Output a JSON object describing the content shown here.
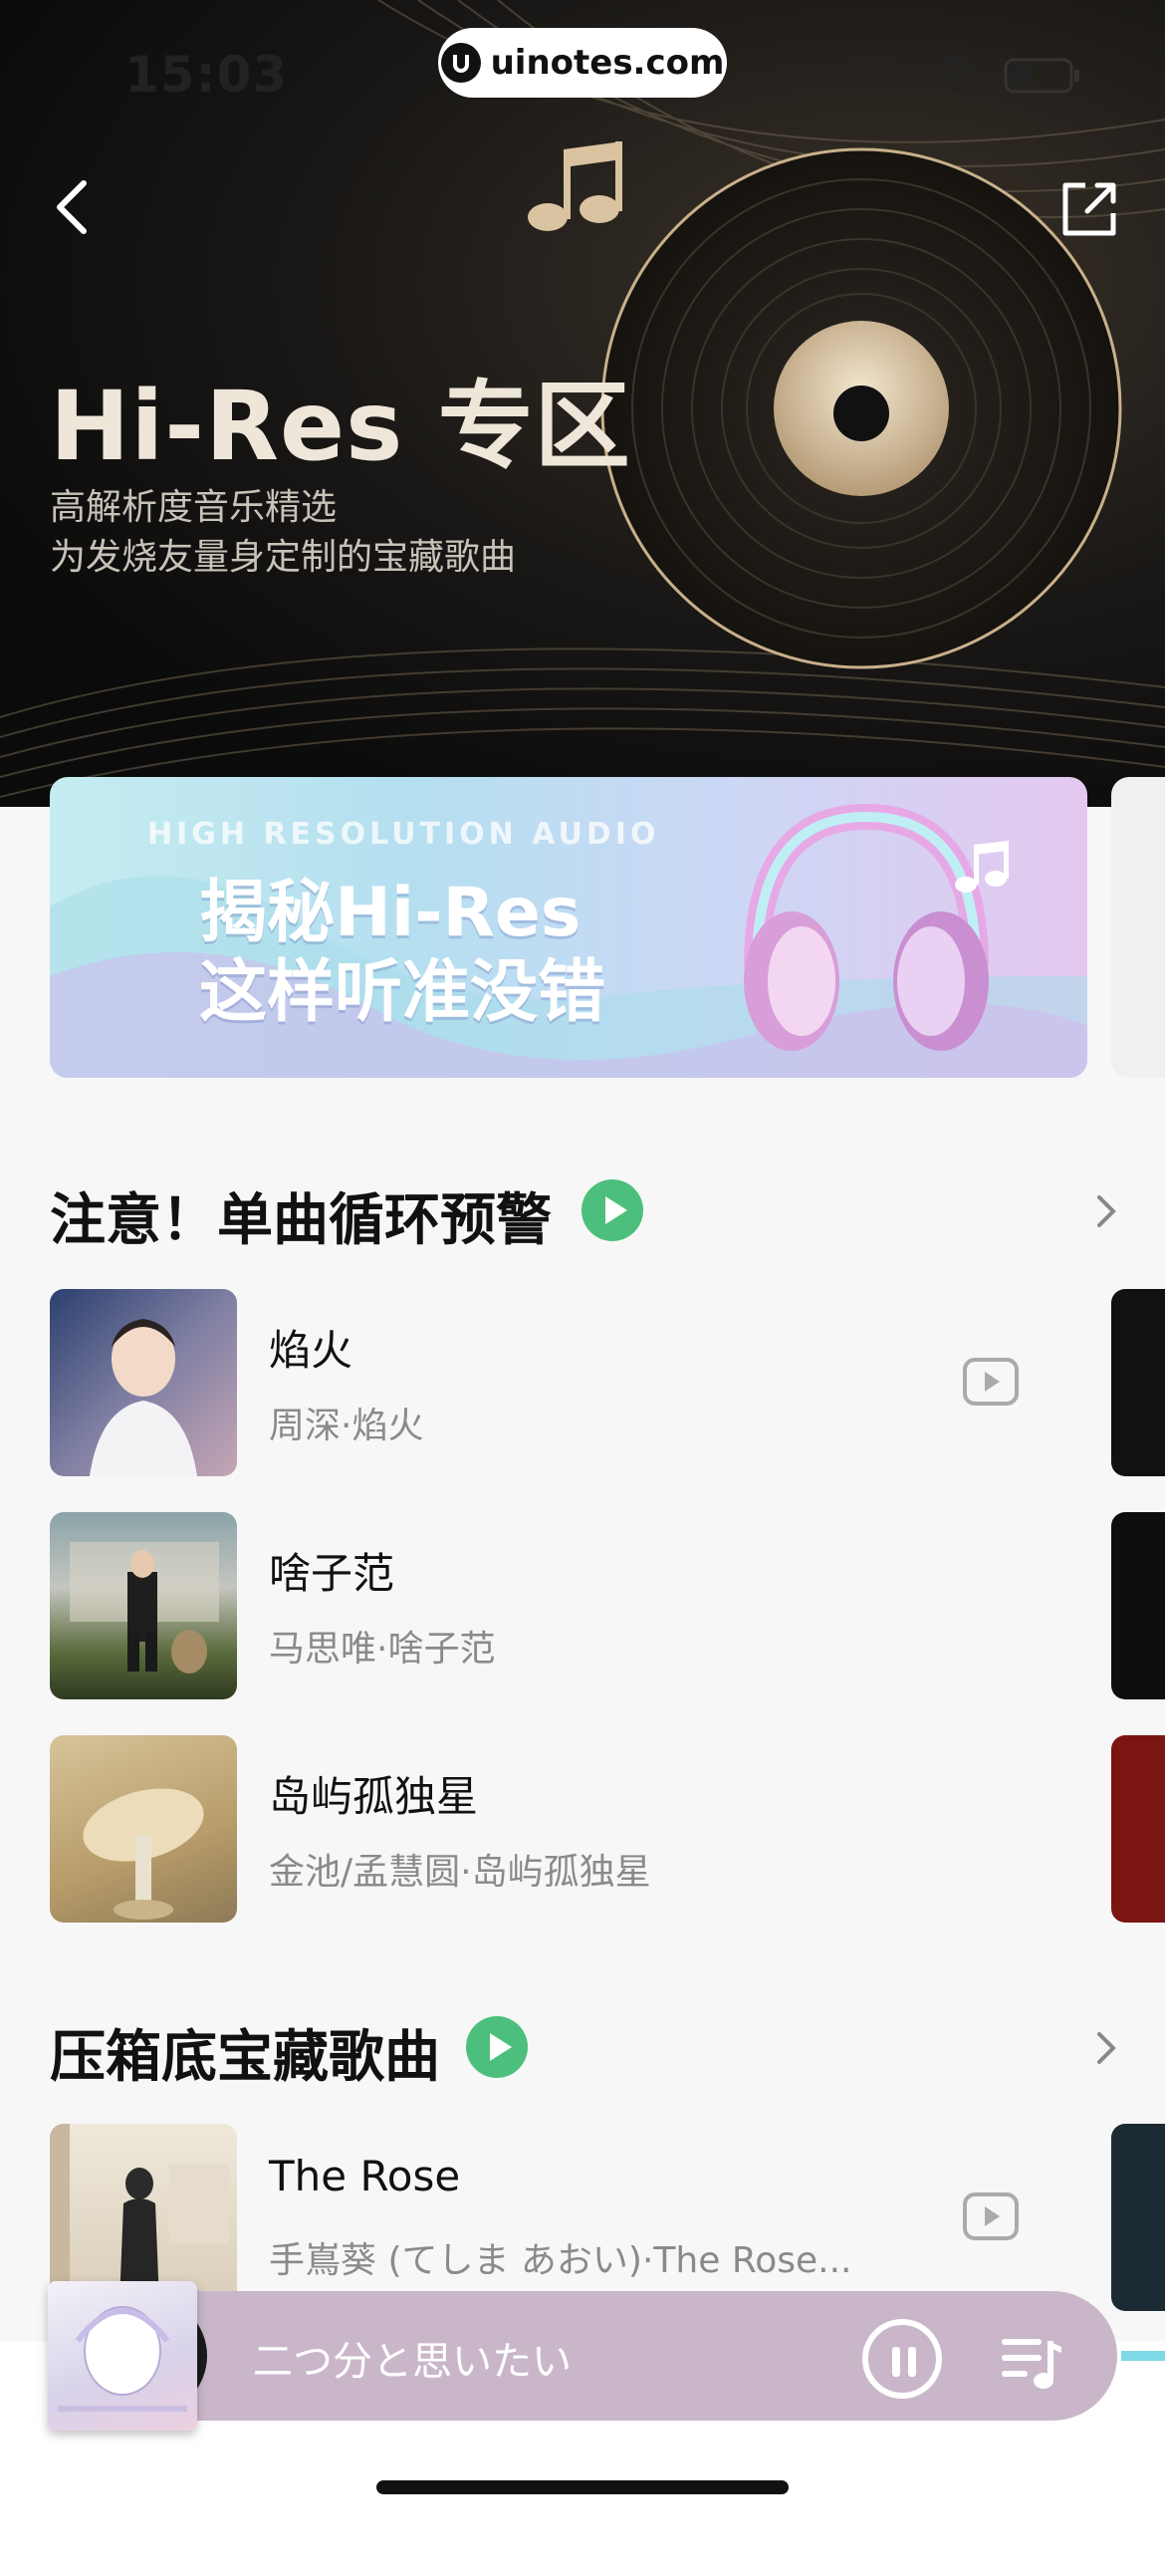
{
  "status_bar": {
    "time": "15:03",
    "watermark": "uinotes.com"
  },
  "hero": {
    "title": "Hi-Res 专区",
    "subtitle_lines": [
      "高解析度音乐精选",
      "为发烧友量身定制的宝藏歌曲"
    ]
  },
  "banner": {
    "small_text": "HIGH RESOLUTION AUDIO",
    "big_lines": [
      "揭秘Hi-Res",
      "这样听准没错"
    ]
  },
  "sections": [
    {
      "title": "注意！单曲循环预警",
      "songs": [
        {
          "name": "焰火",
          "artist": "周深·焰火",
          "has_mv": true
        },
        {
          "name": "啥子范",
          "artist": "马思唯·啥子范",
          "has_mv": false
        },
        {
          "name": "岛屿孤独星",
          "artist": "金池/孟慧圆·岛屿孤独星",
          "has_mv": false
        }
      ]
    },
    {
      "title": "压箱底宝藏歌曲",
      "songs": [
        {
          "name": "The Rose",
          "artist": "手嶌葵 (てしま あおい)·The Rose...",
          "has_mv": true
        }
      ]
    }
  ],
  "mini_player": {
    "track": "二つ分と思いたい",
    "state": "playing"
  },
  "colors": {
    "accent_green": "#4cbf7c",
    "mini_player_bg": "#c9b7c9"
  }
}
